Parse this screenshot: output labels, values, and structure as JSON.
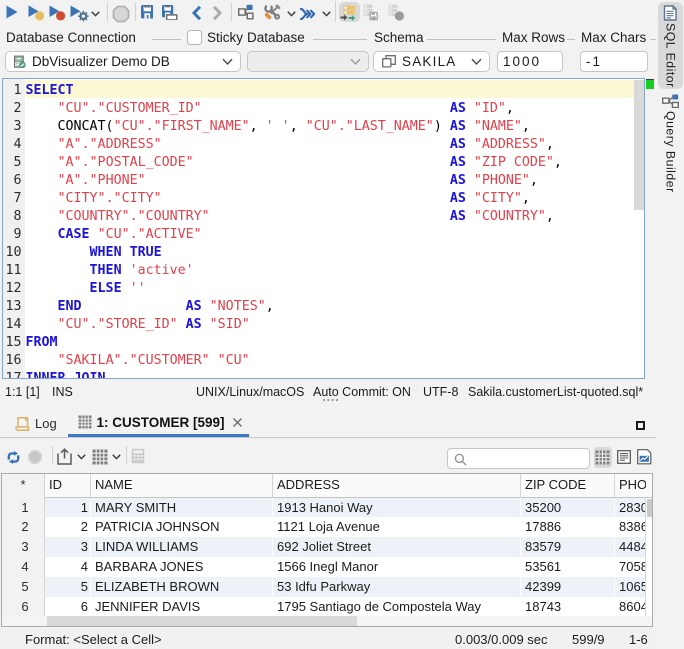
{
  "toolbar": {
    "buttons": [
      {
        "name": "execute"
      },
      {
        "name": "execute-current"
      },
      {
        "name": "execute-buffer"
      },
      {
        "name": "execute-settings"
      },
      {
        "name": "stop"
      },
      {
        "name": "save"
      },
      {
        "name": "save-as"
      },
      {
        "name": "back"
      },
      {
        "name": "forward"
      },
      {
        "name": "explain-plan"
      },
      {
        "name": "tools"
      },
      {
        "name": "continue-on-error"
      },
      {
        "name": "transaction-mode",
        "active": true
      },
      {
        "name": "commit",
        "disabled": true
      },
      {
        "name": "rollback",
        "disabled": true
      }
    ]
  },
  "connection_bar": {
    "database_connection_label": "Database Connection",
    "sticky_label": "Sticky",
    "database_label": "Database",
    "schema_label": "Schema",
    "max_rows_label": "Max Rows",
    "max_chars_label": "Max Chars",
    "connection_value": "DbVisualizer Demo DB",
    "database_value": "",
    "schema_value": "SAKILA",
    "max_rows_value": "1000",
    "max_chars_value": "-1",
    "sticky_checked": false
  },
  "editor": {
    "current_line": 1,
    "lines": [
      {
        "n": 1,
        "seg": [
          [
            "k",
            "SELECT"
          ]
        ]
      },
      {
        "n": 2,
        "seg": [
          [
            "p",
            "    "
          ],
          [
            "s",
            "\"CU\".\"CUSTOMER_ID\""
          ],
          [
            "p",
            "                               "
          ],
          [
            "k",
            "AS"
          ],
          [
            "p",
            " "
          ],
          [
            "s",
            "\"ID\""
          ],
          [
            "p",
            ","
          ]
        ]
      },
      {
        "n": 3,
        "seg": [
          [
            "p",
            "    CONCAT("
          ],
          [
            "s",
            "\"CU\".\"FIRST_NAME\""
          ],
          [
            "p",
            ", "
          ],
          [
            "s",
            "' '"
          ],
          [
            "p",
            ", "
          ],
          [
            "s",
            "\"CU\".\"LAST_NAME\""
          ],
          [
            "p",
            ") "
          ],
          [
            "k",
            "AS"
          ],
          [
            "p",
            " "
          ],
          [
            "s",
            "\"NAME\""
          ],
          [
            "p",
            ","
          ]
        ]
      },
      {
        "n": 4,
        "seg": [
          [
            "p",
            "    "
          ],
          [
            "s",
            "\"A\".\"ADDRESS\""
          ],
          [
            "p",
            "                                    "
          ],
          [
            "k",
            "AS"
          ],
          [
            "p",
            " "
          ],
          [
            "s",
            "\"ADDRESS\""
          ],
          [
            "p",
            ","
          ]
        ]
      },
      {
        "n": 5,
        "seg": [
          [
            "p",
            "    "
          ],
          [
            "s",
            "\"A\".\"POSTAL_CODE\""
          ],
          [
            "p",
            "                                "
          ],
          [
            "k",
            "AS"
          ],
          [
            "p",
            " "
          ],
          [
            "s",
            "\"ZIP CODE\""
          ],
          [
            "p",
            ","
          ]
        ]
      },
      {
        "n": 6,
        "seg": [
          [
            "p",
            "    "
          ],
          [
            "s",
            "\"A\".\"PHONE\""
          ],
          [
            "p",
            "                                      "
          ],
          [
            "k",
            "AS"
          ],
          [
            "p",
            " "
          ],
          [
            "s",
            "\"PHONE\""
          ],
          [
            "p",
            ","
          ]
        ]
      },
      {
        "n": 7,
        "seg": [
          [
            "p",
            "    "
          ],
          [
            "s",
            "\"CITY\".\"CITY\""
          ],
          [
            "p",
            "                                    "
          ],
          [
            "k",
            "AS"
          ],
          [
            "p",
            " "
          ],
          [
            "s",
            "\"CITY\""
          ],
          [
            "p",
            ","
          ]
        ]
      },
      {
        "n": 8,
        "seg": [
          [
            "p",
            "    "
          ],
          [
            "s",
            "\"COUNTRY\".\"COUNTRY\""
          ],
          [
            "p",
            "                              "
          ],
          [
            "k",
            "AS"
          ],
          [
            "p",
            " "
          ],
          [
            "s",
            "\"COUNTRY\""
          ],
          [
            "p",
            ","
          ]
        ]
      },
      {
        "n": 9,
        "seg": [
          [
            "p",
            "    "
          ],
          [
            "k",
            "CASE"
          ],
          [
            "p",
            " "
          ],
          [
            "s",
            "\"CU\".\"ACTIVE\""
          ]
        ]
      },
      {
        "n": 10,
        "seg": [
          [
            "p",
            "        "
          ],
          [
            "k",
            "WHEN"
          ],
          [
            "p",
            " "
          ],
          [
            "k",
            "TRUE"
          ]
        ]
      },
      {
        "n": 11,
        "seg": [
          [
            "p",
            "        "
          ],
          [
            "k",
            "THEN"
          ],
          [
            "p",
            " "
          ],
          [
            "s",
            "'active'"
          ]
        ]
      },
      {
        "n": 12,
        "seg": [
          [
            "p",
            "        "
          ],
          [
            "k",
            "ELSE"
          ],
          [
            "p",
            " "
          ],
          [
            "s",
            "''"
          ]
        ]
      },
      {
        "n": 13,
        "seg": [
          [
            "p",
            "    "
          ],
          [
            "k",
            "END"
          ],
          [
            "p",
            "             "
          ],
          [
            "k",
            "AS"
          ],
          [
            "p",
            " "
          ],
          [
            "s",
            "\"NOTES\""
          ],
          [
            "p",
            ","
          ]
        ]
      },
      {
        "n": 14,
        "seg": [
          [
            "p",
            "    "
          ],
          [
            "s",
            "\"CU\".\"STORE_ID\""
          ],
          [
            "p",
            " "
          ],
          [
            "k",
            "AS"
          ],
          [
            "p",
            " "
          ],
          [
            "s",
            "\"SID\""
          ]
        ]
      },
      {
        "n": 15,
        "seg": [
          [
            "k",
            "FROM"
          ]
        ]
      },
      {
        "n": 16,
        "seg": [
          [
            "p",
            "    "
          ],
          [
            "s",
            "\"SAKILA\".\"CUSTOMER\""
          ],
          [
            "p",
            " "
          ],
          [
            "s",
            "\"CU\""
          ]
        ]
      },
      {
        "n": 17,
        "seg": [
          [
            "k",
            "INNER JOIN"
          ]
        ]
      }
    ]
  },
  "editor_status": {
    "caret": "1:1 [1]",
    "mode": "INS",
    "line_ending": "UNIX/Linux/macOS",
    "auto_commit": "Auto Commit: ON",
    "encoding": "UTF-8",
    "file": "Sakila.customerList-quoted.sql*"
  },
  "results": {
    "tabs": [
      {
        "label": "Log",
        "selected": false
      },
      {
        "label": "1: CUSTOMER [599]",
        "selected": true,
        "closable": true
      }
    ],
    "search_value": ""
  },
  "table": {
    "columns": [
      "*",
      "ID",
      "NAME",
      "ADDRESS",
      "ZIP CODE",
      "PHONE"
    ],
    "rows": [
      {
        "num": "1",
        "id": "1",
        "name": "MARY SMITH",
        "address": "1913 Hanoi Way",
        "zip": "35200",
        "phone": "2830"
      },
      {
        "num": "2",
        "id": "2",
        "name": "PATRICIA JOHNSON",
        "address": "1121 Loja Avenue",
        "zip": "17886",
        "phone": "8386"
      },
      {
        "num": "3",
        "id": "3",
        "name": "LINDA WILLIAMS",
        "address": "692 Joliet Street",
        "zip": "83579",
        "phone": "4484"
      },
      {
        "num": "4",
        "id": "4",
        "name": "BARBARA JONES",
        "address": "1566 Inegl Manor",
        "zip": "53561",
        "phone": "7058"
      },
      {
        "num": "5",
        "id": "5",
        "name": "ELIZABETH BROWN",
        "address": "53 Idfu Parkway",
        "zip": "42399",
        "phone": "1065"
      },
      {
        "num": "6",
        "id": "6",
        "name": "JENNIFER DAVIS",
        "address": "1795 Santiago de Compostela Way",
        "zip": "18743",
        "phone": "8604"
      }
    ]
  },
  "result_status": {
    "format": "Format: <Select a Cell>",
    "timing": "0.003/0.009 sec",
    "rows_cols": "599/9",
    "range": "1-6"
  },
  "side_tabs": [
    {
      "label": "SQL Editor",
      "selected": true
    },
    {
      "label": "Query Builder",
      "selected": false
    }
  ],
  "colors": {
    "accent_blue": "#3b77c8",
    "icon_blue": "#3b74b5",
    "keyword": "#1b13da",
    "string": "#e2414b",
    "current_line": "#fbf8d3",
    "ok_indicator": "#18cd22",
    "row_alt": "#edf2f9"
  }
}
